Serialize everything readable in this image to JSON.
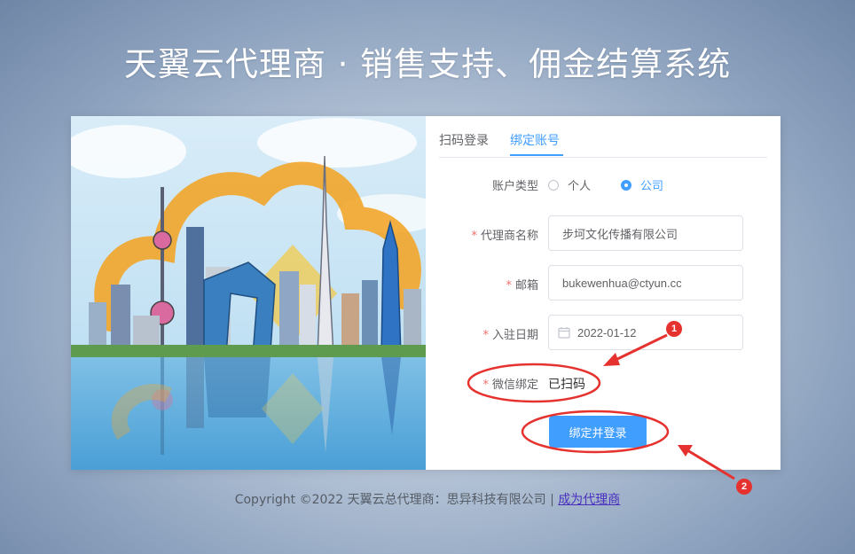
{
  "header": {
    "title": "天翼云代理商 · 销售支持、佣金结算系统"
  },
  "tabs": [
    {
      "label": "扫码登录",
      "active": false
    },
    {
      "label": "绑定账号",
      "active": true
    }
  ],
  "form": {
    "account_type": {
      "label": "账户类型",
      "options": [
        {
          "label": "个人",
          "checked": false
        },
        {
          "label": "公司",
          "checked": true
        }
      ]
    },
    "agent_name": {
      "label": "代理商名称",
      "value": "步坷文化传播有限公司"
    },
    "email": {
      "label": "邮箱",
      "value": "bukewenhua@ctyun.cc"
    },
    "join_date": {
      "label": "入驻日期",
      "value": "2022-01-12"
    },
    "wechat": {
      "label": "微信绑定",
      "value": "已扫码"
    },
    "submit_label": "绑定并登录",
    "required_mark": "*"
  },
  "footer": {
    "text": "Copyright ©2022 天翼云总代理商：思异科技有限公司 | ",
    "link": "成为代理商"
  },
  "annotations": {
    "badge_1": "1",
    "badge_2": "2",
    "color": "#e6322e"
  },
  "colors": {
    "primary": "#409eff",
    "required": "#f56c6c",
    "annotation": "#e6322e"
  }
}
